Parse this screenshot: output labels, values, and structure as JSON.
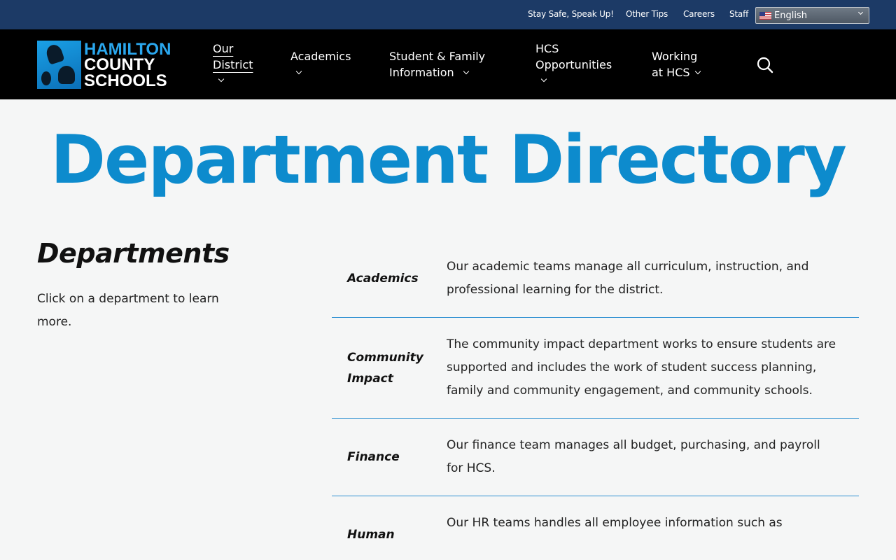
{
  "topbar": {
    "links": [
      {
        "label": "Stay Safe, Speak Up!"
      },
      {
        "label": "Other Tips"
      },
      {
        "label": "Careers"
      },
      {
        "label": "Staff"
      }
    ],
    "language": {
      "selected": "English",
      "icon": "us-flag-icon"
    }
  },
  "logo": {
    "line1": "HAMILTON",
    "line2": "COUNTY",
    "line3": "SCHOOLS"
  },
  "nav": {
    "items": [
      {
        "label": "Our\nDistrict",
        "active": true
      },
      {
        "label": "Academics",
        "active": false
      },
      {
        "label": "Student & Family\nInformation",
        "active": false
      },
      {
        "label": "HCS\nOpportunities",
        "active": false
      },
      {
        "label": "Working\nat HCS",
        "active": false
      }
    ],
    "search_icon": "search-icon"
  },
  "page": {
    "title": "Department Directory"
  },
  "sidebar": {
    "heading": "Departments",
    "description": "Click on a department to learn more."
  },
  "departments": [
    {
      "name": "Academics",
      "description": "Our academic teams manage all curriculum, instruction, and professional learning for the district."
    },
    {
      "name": "Community Impact",
      "description": "The community impact department works to ensure students are supported and includes the work of student success planning, family and community engagement, and community schools."
    },
    {
      "name": "Finance",
      "description": "Our finance team manages all budget, purchasing, and payroll for HCS."
    },
    {
      "name": "Human",
      "description": "Our HR teams handles all employee information such as"
    }
  ],
  "colors": {
    "topbar": "#1c3a66",
    "navbar": "#000000",
    "accent": "#0d8bcd",
    "divider": "#2c8fd1",
    "background": "#f5f6f6"
  }
}
